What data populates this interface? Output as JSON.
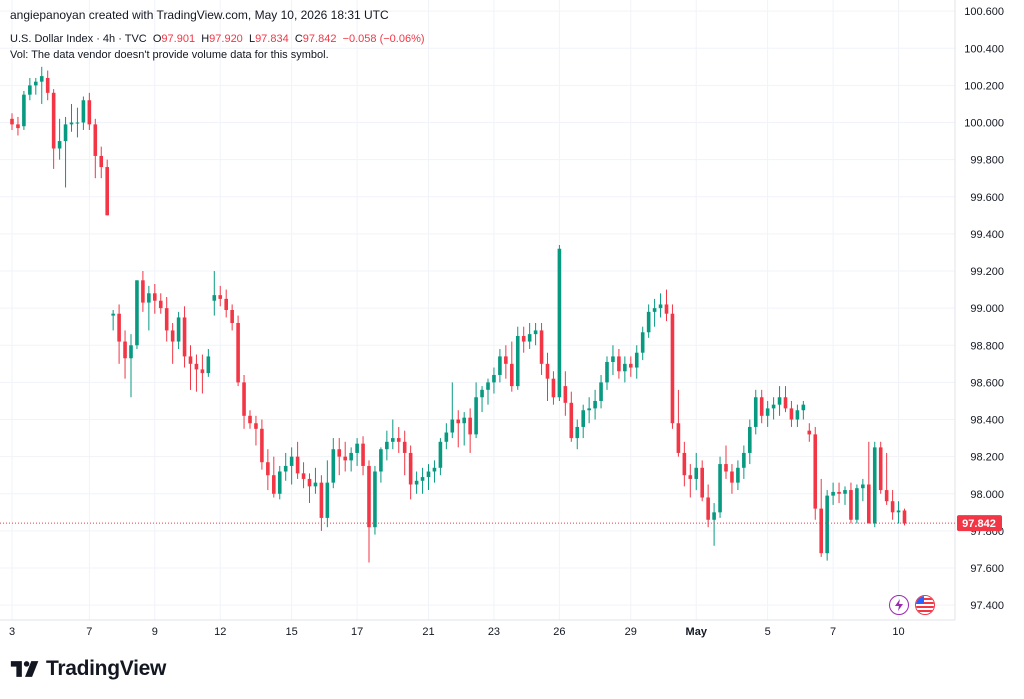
{
  "header": {
    "credit": "angiepanoyan created with TradingView.com, May 10, 2026 18:31 UTC",
    "symbol": "U.S. Dollar Index · 4h · TVC",
    "open_label": "O",
    "open": "97.901",
    "high_label": "H",
    "high": "97.920",
    "low_label": "L",
    "low": "97.834",
    "close_label": "C",
    "close": "97.842",
    "change": "−0.058 (−0.06%)",
    "volume_note": "Vol: The data vendor doesn't provide volume data for this symbol."
  },
  "brand": {
    "name": "TradingView"
  },
  "icons": {
    "flash": "flash-icon",
    "flag": "us-flag-icon"
  },
  "colors": {
    "up": "#089981",
    "down": "#f23645",
    "grid": "#f0f3fa",
    "price_line": "#f23645"
  },
  "chart_data": {
    "type": "candlestick",
    "title": "U.S. Dollar Index · 4h · TVC",
    "ylim": [
      97.32,
      100.66
    ],
    "y_ticks": [
      "100.600",
      "100.400",
      "100.200",
      "100.000",
      "99.800",
      "99.600",
      "99.400",
      "99.200",
      "99.000",
      "98.800",
      "98.600",
      "98.400",
      "98.200",
      "98.000",
      "97.800",
      "97.600",
      "97.400"
    ],
    "x_ticks": [
      {
        "label": "3",
        "index": 0
      },
      {
        "label": "7",
        "index": 13
      },
      {
        "label": "9",
        "index": 24
      },
      {
        "label": "12",
        "index": 35
      },
      {
        "label": "15",
        "index": 47
      },
      {
        "label": "17",
        "index": 58
      },
      {
        "label": "21",
        "index": 70
      },
      {
        "label": "23",
        "index": 81
      },
      {
        "label": "26",
        "index": 92
      },
      {
        "label": "29",
        "index": 104
      },
      {
        "label": "May",
        "index": 115
      },
      {
        "label": "5",
        "index": 127
      },
      {
        "label": "7",
        "index": 138
      },
      {
        "label": "10",
        "index": 149
      }
    ],
    "grid": true,
    "last_price": "97.842",
    "candles": [
      [
        100.02,
        100.05,
        99.96,
        99.99
      ],
      [
        99.99,
        100.03,
        99.93,
        99.97
      ],
      [
        99.98,
        100.17,
        99.96,
        100.15
      ],
      [
        100.15,
        100.24,
        100.12,
        100.2
      ],
      [
        100.2,
        100.24,
        100.15,
        100.22
      ],
      [
        100.22,
        100.3,
        100.1,
        100.25
      ],
      [
        100.24,
        100.28,
        100.12,
        100.16
      ],
      [
        100.16,
        100.18,
        99.75,
        99.86
      ],
      [
        99.86,
        100.02,
        99.8,
        99.9
      ],
      [
        99.9,
        100.03,
        99.65,
        99.99
      ],
      [
        99.99,
        100.1,
        99.95,
        100.0
      ],
      [
        100.0,
        100.08,
        99.92,
        100.0
      ],
      [
        100.0,
        100.14,
        99.96,
        100.12
      ],
      [
        100.12,
        100.16,
        99.96,
        99.99
      ],
      [
        99.99,
        100.02,
        99.7,
        99.82
      ],
      [
        99.82,
        99.87,
        99.7,
        99.76
      ],
      [
        99.76,
        99.8,
        99.5,
        99.5
      ],
      [
        98.96,
        98.99,
        98.88,
        98.97
      ],
      [
        98.97,
        99.02,
        98.7,
        98.82
      ],
      [
        98.82,
        98.88,
        98.62,
        98.73
      ],
      [
        98.73,
        98.86,
        98.52,
        98.8
      ],
      [
        98.8,
        99.15,
        98.78,
        99.15
      ],
      [
        99.15,
        99.2,
        98.98,
        99.03
      ],
      [
        99.03,
        99.12,
        98.88,
        99.08
      ],
      [
        99.08,
        99.13,
        98.97,
        99.04
      ],
      [
        99.04,
        99.08,
        98.97,
        99.0
      ],
      [
        99.0,
        99.06,
        98.82,
        98.88
      ],
      [
        98.88,
        98.92,
        98.7,
        98.82
      ],
      [
        98.82,
        98.98,
        98.78,
        98.95
      ],
      [
        98.95,
        99.01,
        98.68,
        98.74
      ],
      [
        98.74,
        98.8,
        98.56,
        98.7
      ],
      [
        98.7,
        98.75,
        98.55,
        98.67
      ],
      [
        98.67,
        98.75,
        98.54,
        98.65
      ],
      [
        98.65,
        98.78,
        98.63,
        98.74
      ],
      [
        99.04,
        99.2,
        98.96,
        99.07
      ],
      [
        99.07,
        99.12,
        99.01,
        99.05
      ],
      [
        99.05,
        99.1,
        98.95,
        98.99
      ],
      [
        98.99,
        99.02,
        98.88,
        98.92
      ],
      [
        98.92,
        98.96,
        98.58,
        98.6
      ],
      [
        98.6,
        98.64,
        98.35,
        98.42
      ],
      [
        98.42,
        98.45,
        98.35,
        98.38
      ],
      [
        98.38,
        98.42,
        98.26,
        98.35
      ],
      [
        98.35,
        98.4,
        98.13,
        98.17
      ],
      [
        98.17,
        98.24,
        98.02,
        98.1
      ],
      [
        98.1,
        98.2,
        97.98,
        98.0
      ],
      [
        98.0,
        98.15,
        97.97,
        98.12
      ],
      [
        98.12,
        98.22,
        98.07,
        98.15
      ],
      [
        98.15,
        98.25,
        98.05,
        98.2
      ],
      [
        98.2,
        98.28,
        98.08,
        98.11
      ],
      [
        98.11,
        98.17,
        98.03,
        98.08
      ],
      [
        98.08,
        98.11,
        97.95,
        98.04
      ],
      [
        98.04,
        98.14,
        98.0,
        98.06
      ],
      [
        98.06,
        98.1,
        97.8,
        97.87
      ],
      [
        97.87,
        98.18,
        97.82,
        98.06
      ],
      [
        98.06,
        98.3,
        98.03,
        98.24
      ],
      [
        98.24,
        98.3,
        98.1,
        98.2
      ],
      [
        98.2,
        98.28,
        98.12,
        98.18
      ],
      [
        98.18,
        98.25,
        98.12,
        98.22
      ],
      [
        98.22,
        98.3,
        98.15,
        98.27
      ],
      [
        98.27,
        98.31,
        98.1,
        98.15
      ],
      [
        98.15,
        98.18,
        97.63,
        97.82
      ],
      [
        97.82,
        98.15,
        97.78,
        98.12
      ],
      [
        98.12,
        98.25,
        98.06,
        98.24
      ],
      [
        98.24,
        98.34,
        98.18,
        98.28
      ],
      [
        98.28,
        98.4,
        98.24,
        98.3
      ],
      [
        98.3,
        98.36,
        98.22,
        98.28
      ],
      [
        98.28,
        98.34,
        98.1,
        98.22
      ],
      [
        98.22,
        98.26,
        97.97,
        98.05
      ],
      [
        98.05,
        98.12,
        98.0,
        98.07
      ],
      [
        98.07,
        98.14,
        98.0,
        98.09
      ],
      [
        98.09,
        98.16,
        98.02,
        98.12
      ],
      [
        98.12,
        98.18,
        98.06,
        98.14
      ],
      [
        98.14,
        98.3,
        98.1,
        98.28
      ],
      [
        98.28,
        98.38,
        98.24,
        98.33
      ],
      [
        98.33,
        98.6,
        98.3,
        98.4
      ],
      [
        98.4,
        98.45,
        98.25,
        98.38
      ],
      [
        98.38,
        98.44,
        98.26,
        98.41
      ],
      [
        98.41,
        98.46,
        98.22,
        98.32
      ],
      [
        98.32,
        98.6,
        98.3,
        98.52
      ],
      [
        98.52,
        98.58,
        98.44,
        98.56
      ],
      [
        98.56,
        98.62,
        98.48,
        98.6
      ],
      [
        98.6,
        98.68,
        98.54,
        98.64
      ],
      [
        98.64,
        98.78,
        98.6,
        98.74
      ],
      [
        98.74,
        98.8,
        98.62,
        98.7
      ],
      [
        98.7,
        98.82,
        98.55,
        98.58
      ],
      [
        98.58,
        98.9,
        98.56,
        98.85
      ],
      [
        98.85,
        98.9,
        98.76,
        98.82
      ],
      [
        98.82,
        98.92,
        98.78,
        98.86
      ],
      [
        98.86,
        98.92,
        98.8,
        98.88
      ],
      [
        98.88,
        98.92,
        98.64,
        98.7
      ],
      [
        98.7,
        98.76,
        98.5,
        98.62
      ],
      [
        98.62,
        98.66,
        98.48,
        98.52
      ],
      [
        98.52,
        99.34,
        98.5,
        99.32
      ],
      [
        98.58,
        98.66,
        98.42,
        98.49
      ],
      [
        98.49,
        98.55,
        98.28,
        98.3
      ],
      [
        98.3,
        98.4,
        98.24,
        98.36
      ],
      [
        98.36,
        98.48,
        98.3,
        98.45
      ],
      [
        98.45,
        98.52,
        98.38,
        98.46
      ],
      [
        98.46,
        98.56,
        98.4,
        98.5
      ],
      [
        98.5,
        98.64,
        98.46,
        98.6
      ],
      [
        98.6,
        98.74,
        98.56,
        98.71
      ],
      [
        98.71,
        98.8,
        98.64,
        98.74
      ],
      [
        98.74,
        98.78,
        98.62,
        98.66
      ],
      [
        98.66,
        98.74,
        98.6,
        98.7
      ],
      [
        98.7,
        98.74,
        98.63,
        98.68
      ],
      [
        98.68,
        98.8,
        98.62,
        98.76
      ],
      [
        98.76,
        98.9,
        98.72,
        98.87
      ],
      [
        98.87,
        99.02,
        98.84,
        98.98
      ],
      [
        98.98,
        99.05,
        98.9,
        99.0
      ],
      [
        99.0,
        99.08,
        98.95,
        99.02
      ],
      [
        99.02,
        99.1,
        98.93,
        98.97
      ],
      [
        98.97,
        99.02,
        98.35,
        98.38
      ],
      [
        98.38,
        98.56,
        98.2,
        98.22
      ],
      [
        98.22,
        98.28,
        98.04,
        98.1
      ],
      [
        98.1,
        98.16,
        97.98,
        98.08
      ],
      [
        98.08,
        98.22,
        98.02,
        98.14
      ],
      [
        98.14,
        98.18,
        97.96,
        97.98
      ],
      [
        97.98,
        98.05,
        97.82,
        97.86
      ],
      [
        97.86,
        97.95,
        97.72,
        97.9
      ],
      [
        97.9,
        98.2,
        97.87,
        98.16
      ],
      [
        98.16,
        98.26,
        98.08,
        98.12
      ],
      [
        98.12,
        98.16,
        98.0,
        98.06
      ],
      [
        98.06,
        98.18,
        98.02,
        98.14
      ],
      [
        98.14,
        98.26,
        98.08,
        98.22
      ],
      [
        98.22,
        98.4,
        98.16,
        98.36
      ],
      [
        98.36,
        98.56,
        98.32,
        98.52
      ],
      [
        98.52,
        98.56,
        98.38,
        98.42
      ],
      [
        98.42,
        98.5,
        98.36,
        98.46
      ],
      [
        98.46,
        98.52,
        98.4,
        98.48
      ],
      [
        98.48,
        98.58,
        98.42,
        98.52
      ],
      [
        98.52,
        98.58,
        98.44,
        98.46
      ],
      [
        98.46,
        98.5,
        98.36,
        98.4
      ],
      [
        98.4,
        98.48,
        98.36,
        98.45
      ],
      [
        98.45,
        98.5,
        98.4,
        98.48
      ],
      [
        98.34,
        98.38,
        98.28,
        98.32
      ],
      [
        98.32,
        98.36,
        97.86,
        97.92
      ],
      [
        97.92,
        98.08,
        97.66,
        97.68
      ],
      [
        97.68,
        98.02,
        97.64,
        97.99
      ],
      [
        97.99,
        98.06,
        97.94,
        98.01
      ],
      [
        98.01,
        98.06,
        97.95,
        98.0
      ],
      [
        98.0,
        98.04,
        97.94,
        98.02
      ],
      [
        98.02,
        98.06,
        97.84,
        97.86
      ],
      [
        97.86,
        98.05,
        97.84,
        98.03
      ],
      [
        98.03,
        98.08,
        97.96,
        98.05
      ],
      [
        98.05,
        98.28,
        97.84,
        97.84
      ],
      [
        97.84,
        98.28,
        97.82,
        98.25
      ],
      [
        98.25,
        98.28,
        98.0,
        98.02
      ],
      [
        98.02,
        98.22,
        97.94,
        97.96
      ],
      [
        97.96,
        98.02,
        97.86,
        97.9
      ],
      [
        97.9,
        97.96,
        97.84,
        97.91
      ],
      [
        97.91,
        97.92,
        97.83,
        97.84
      ]
    ]
  }
}
